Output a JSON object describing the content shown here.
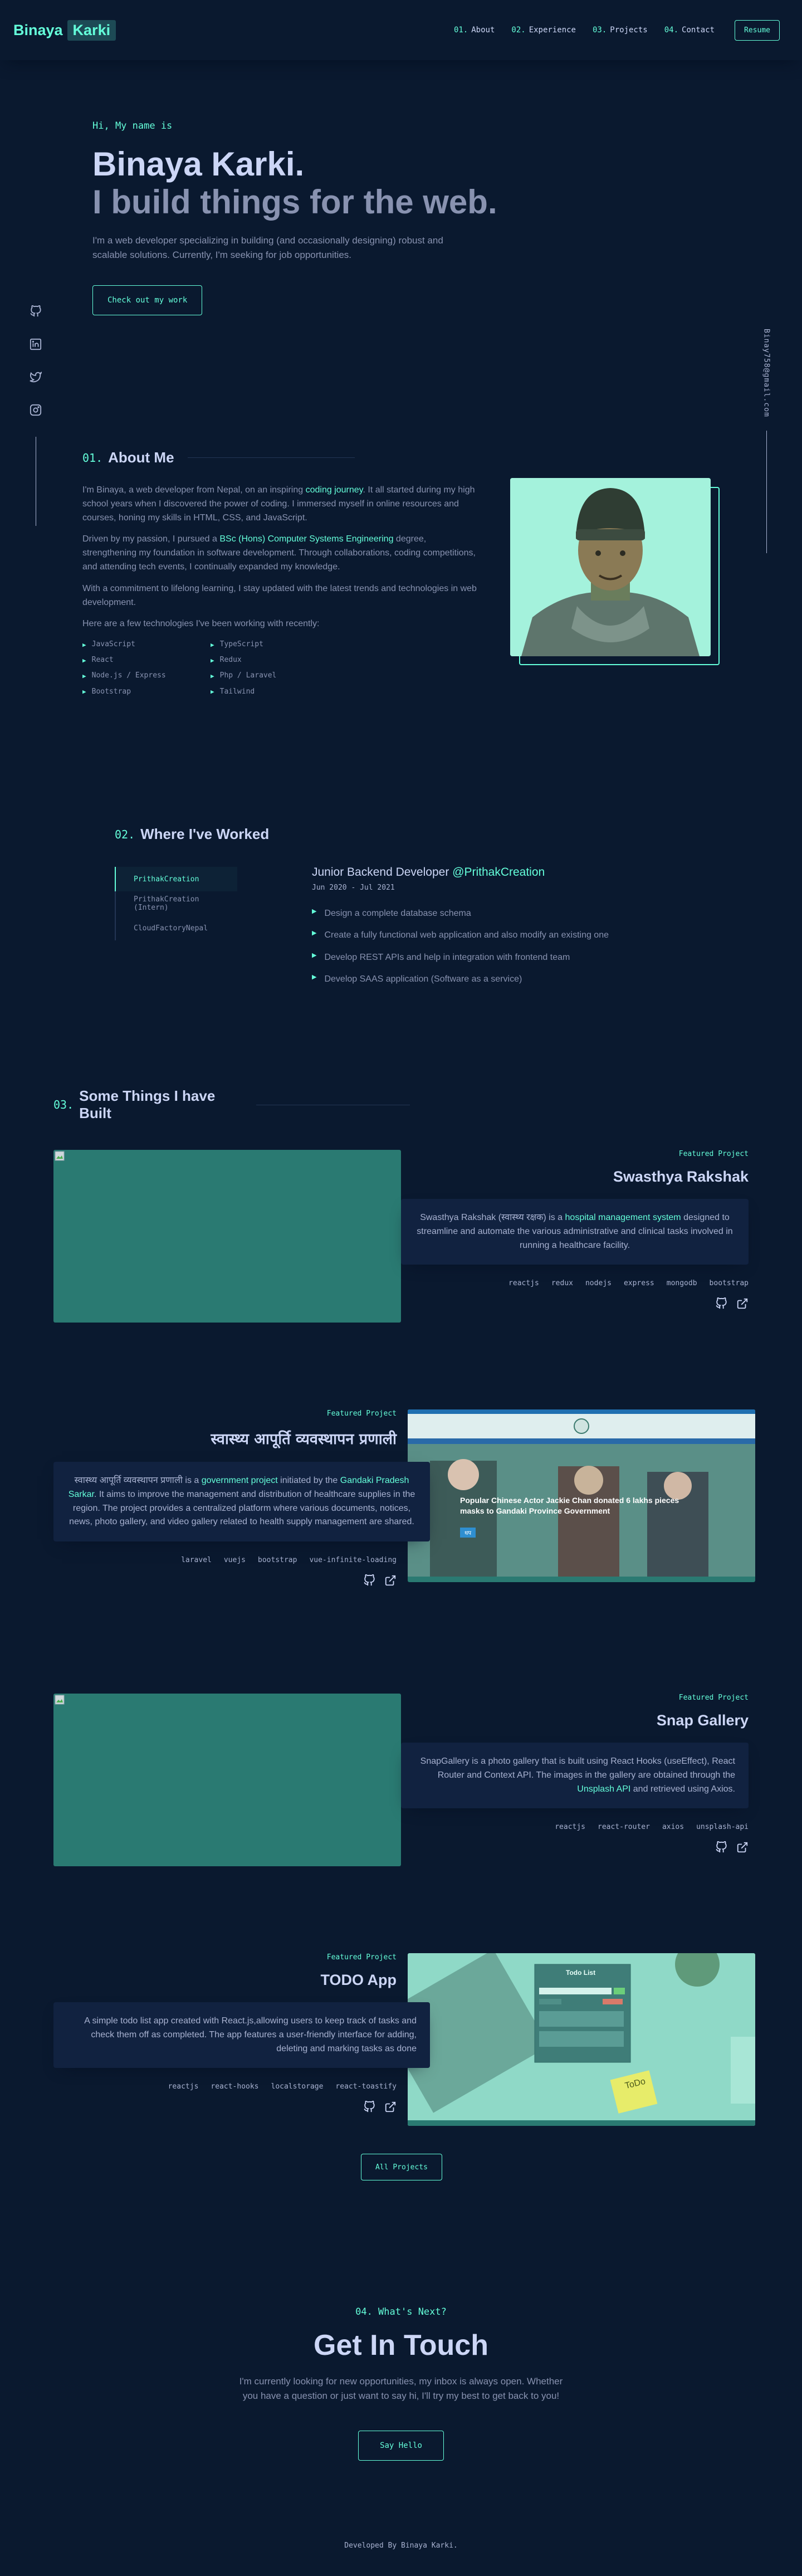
{
  "header": {
    "logo_first": "Binaya",
    "logo_last": "Karki",
    "nav": [
      {
        "num": "01.",
        "label": "About"
      },
      {
        "num": "02.",
        "label": "Experience"
      },
      {
        "num": "03.",
        "label": "Projects"
      },
      {
        "num": "04.",
        "label": "Contact"
      }
    ],
    "resume_label": "Resume"
  },
  "social": {
    "icons": [
      "github-icon",
      "linkedin-icon",
      "twitter-icon",
      "instagram-icon"
    ]
  },
  "email": "Binay758@gmail.com",
  "hero": {
    "intro": "Hi, My name is",
    "name": "Binaya Karki.",
    "tagline": "I build things for the web.",
    "description": "I'm a web developer specializing in building (and occasionally designing) robust and scalable solutions. Currently, I'm seeking for job opportunities.",
    "button": "Check out my work"
  },
  "about": {
    "num": "01.",
    "title": "About Me",
    "p1_a": "I'm Binaya, a web developer from Nepal, on an inspiring ",
    "p1_hl": "coding journey",
    "p1_b": ". It all started during my high school years when I discovered the power of coding. I immersed myself in online resources and courses, honing my skills in HTML, CSS, and JavaScript.",
    "p2_a": "Driven by my passion, I pursued a ",
    "p2_hl": "BSc (Hons) Computer Systems Engineering",
    "p2_b": " degree, strengthening my foundation in software development. Through collaborations, coding competitions, and attending tech events, I continually expanded my knowledge.",
    "p3": "With a commitment to lifelong learning, I stay updated with the latest trends and technologies in web development.",
    "p4": "Here are a few technologies I've been working with recently:",
    "technologies": [
      "JavaScript",
      "TypeScript",
      "React",
      "Redux",
      "Node.js / Express",
      "Php / Laravel",
      "Bootstrap",
      "Tailwind"
    ]
  },
  "experience": {
    "num": "02.",
    "title": "Where I've Worked",
    "tabs": [
      "PrithakCreation",
      "PrithakCreation (Intern)",
      "CloudFactoryNepal"
    ],
    "active": {
      "role": "Junior Backend Developer",
      "company": "@PrithakCreation",
      "date": "Jun 2020 - Jul 2021",
      "duties": [
        "Design a complete database schema",
        "Create a fully functional web application and also modify an existing one",
        "Develop REST APIs and help in integration with frontend team",
        "Develop SAAS application (Software as a service)"
      ]
    }
  },
  "projects": {
    "num": "03.",
    "title": "Some Things I have Built",
    "overline": "Featured Project",
    "items": [
      {
        "title": "Swasthya Rakshak",
        "desc_a": "Swasthya Rakshak (स्वास्थ्य रक्षक) is a ",
        "desc_hl": "hospital management system",
        "desc_b": " designed to streamline and automate the various administrative and clinical tasks involved in running a healthcare facility.",
        "tech": [
          "reactjs",
          "redux",
          "nodejs",
          "express",
          "mongodb",
          "bootstrap"
        ]
      },
      {
        "title": "स्वास्थ्य आपूर्ति व्यवस्थापन प्रणाली",
        "desc_a": "स्वास्थ्य आपूर्ति व्यवस्थापन प्रणाली is a ",
        "desc_hl": "government project",
        "desc_b": " initiated by the ",
        "desc_hl2": "Gandaki Pradesh Sarkar",
        "desc_c": ". It aims to improve the management and distribution of healthcare supplies in the region. The project provides a centralized platform where various documents, notices, news, photo gallery, and video gallery related to health supply management are shared.",
        "tech": [
          "laravel",
          "vuejs",
          "bootstrap",
          "vue-infinite-loading"
        ],
        "image_headline": "Popular Chinese Actor Jackie Chan donated 6 lakhs pieces masks to Gandaki Province Government",
        "image_button": "थप"
      },
      {
        "title": "Snap Gallery",
        "desc_a": "SnapGallery is a photo gallery that is built using React Hooks (useEffect), React Router and Context API. The images in the gallery are obtained through the ",
        "desc_hl": "Unsplash API",
        "desc_b": " and retrieved using Axios.",
        "tech": [
          "reactjs",
          "react-router",
          "axios",
          "unsplash-api"
        ]
      },
      {
        "title": "TODO App",
        "desc": "A simple todo list app created with React.js,allowing users to keep track of tasks and check them off as completed. The app features a user-friendly interface for adding, deleting and marking tasks as done",
        "tech": [
          "reactjs",
          "react-hooks",
          "localstorage",
          "react-toastify"
        ],
        "image_title": "Todo List",
        "image_note": "ToDo"
      }
    ],
    "all_button": "All Projects"
  },
  "contact": {
    "overline": "04. What's Next?",
    "title": "Get In Touch",
    "description": "I'm currently looking for new opportunities, my inbox is always open. Whether you have a question or just want to say hi, I'll try my best to get back to you!",
    "button": "Say Hello"
  },
  "footer": "Developed By Binaya Karki."
}
